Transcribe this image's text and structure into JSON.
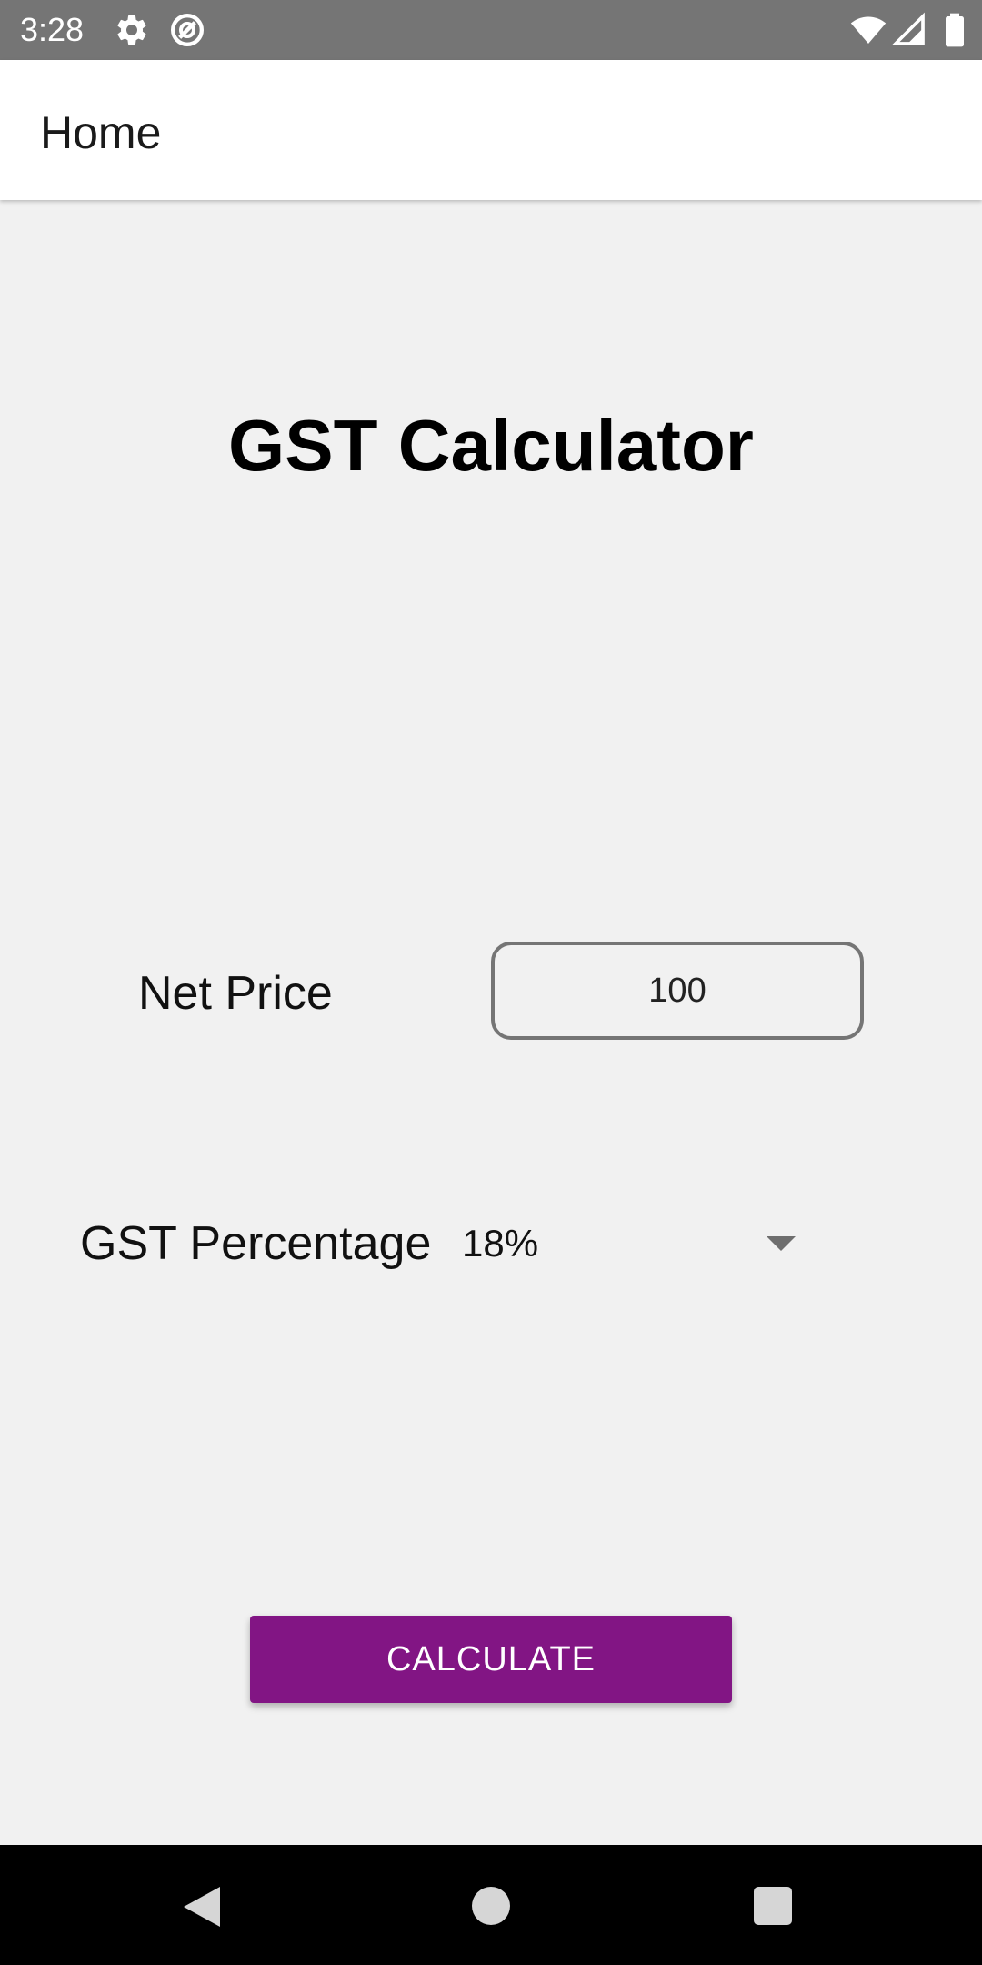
{
  "status_bar": {
    "time": "3:28",
    "icons": [
      "gear-icon",
      "sync-icon",
      "wifi-icon",
      "signal-icon",
      "battery-icon"
    ]
  },
  "app_bar": {
    "title": "Home"
  },
  "main": {
    "title": "GST Calculator",
    "net_price": {
      "label": "Net Price",
      "value": "100"
    },
    "gst_percentage": {
      "label": "GST Percentage",
      "selected": "18%"
    },
    "calculate_button": {
      "label": "CALCULATE"
    }
  },
  "nav_bar": {
    "icons": [
      "back-icon",
      "home-icon",
      "recents-icon"
    ]
  },
  "colors": {
    "status_bar": "#757575",
    "background": "#f1f1f1",
    "button": "#821584",
    "input_border": "#757575"
  }
}
